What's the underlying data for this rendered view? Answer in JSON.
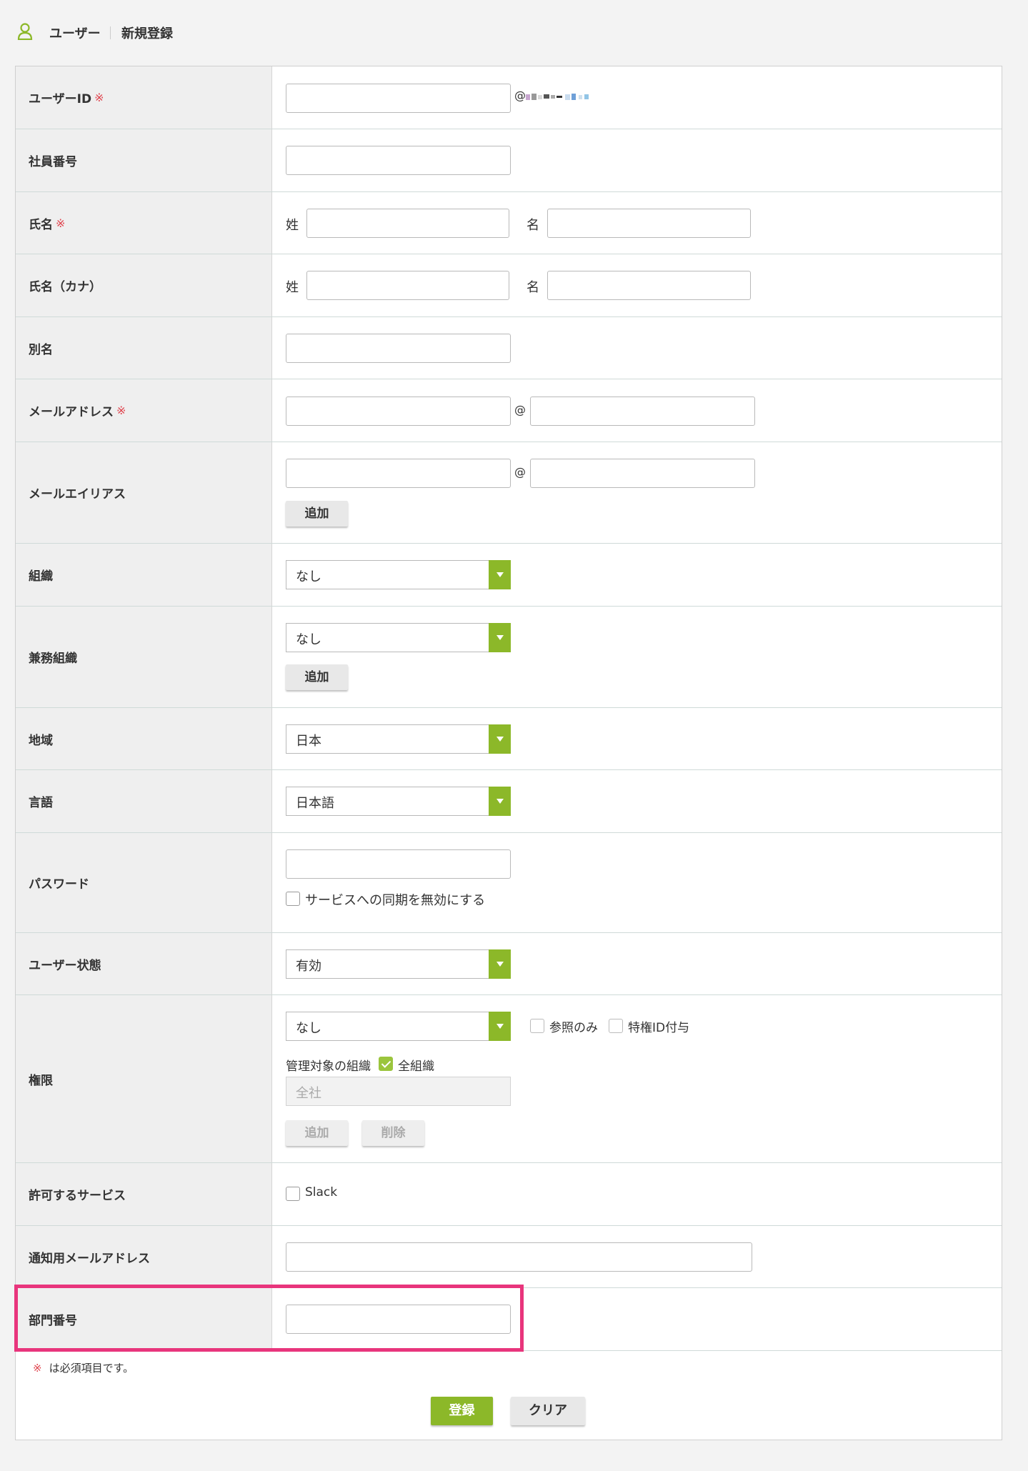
{
  "breadcrumb": {
    "section": "ユーザー",
    "page": "新規登録"
  },
  "required_mark": "※",
  "fields": {
    "user_id": {
      "label": "ユーザーID",
      "suffix": "@"
    },
    "employee_no": {
      "label": "社員番号"
    },
    "name": {
      "label": "氏名",
      "sei": "姓",
      "mei": "名"
    },
    "name_kana": {
      "label": "氏名（カナ）",
      "sei": "姓",
      "mei": "名"
    },
    "alias": {
      "label": "別名"
    },
    "email": {
      "label": "メールアドレス",
      "at": "@"
    },
    "email_alias": {
      "label": "メールエイリアス",
      "at": "@",
      "add": "追加"
    },
    "org": {
      "label": "組織",
      "value": "なし"
    },
    "sub_org": {
      "label": "兼務組織",
      "value": "なし",
      "add": "追加"
    },
    "region": {
      "label": "地域",
      "value": "日本"
    },
    "language": {
      "label": "言語",
      "value": "日本語"
    },
    "password": {
      "label": "パスワード",
      "checkbox": "サービスへの同期を無効にする"
    },
    "status": {
      "label": "ユーザー状態",
      "value": "有効"
    },
    "permission": {
      "label": "権限",
      "value": "なし",
      "readonly": "参照のみ",
      "privileged": "特権ID付与",
      "managed_org": "管理対象の組織",
      "all_orgs": "全組織",
      "org_placeholder": "全社",
      "add": "追加",
      "delete": "削除"
    },
    "services": {
      "label": "許可するサービス",
      "slack": "Slack"
    },
    "notify_email": {
      "label": "通知用メールアドレス"
    },
    "dept_no": {
      "label": "部門番号"
    }
  },
  "note": "は必須項目です。",
  "buttons": {
    "submit": "登録",
    "clear": "クリア"
  },
  "colors": {
    "accent": "#8cb829",
    "required": "#e0454f",
    "highlight": "#e8357c"
  }
}
